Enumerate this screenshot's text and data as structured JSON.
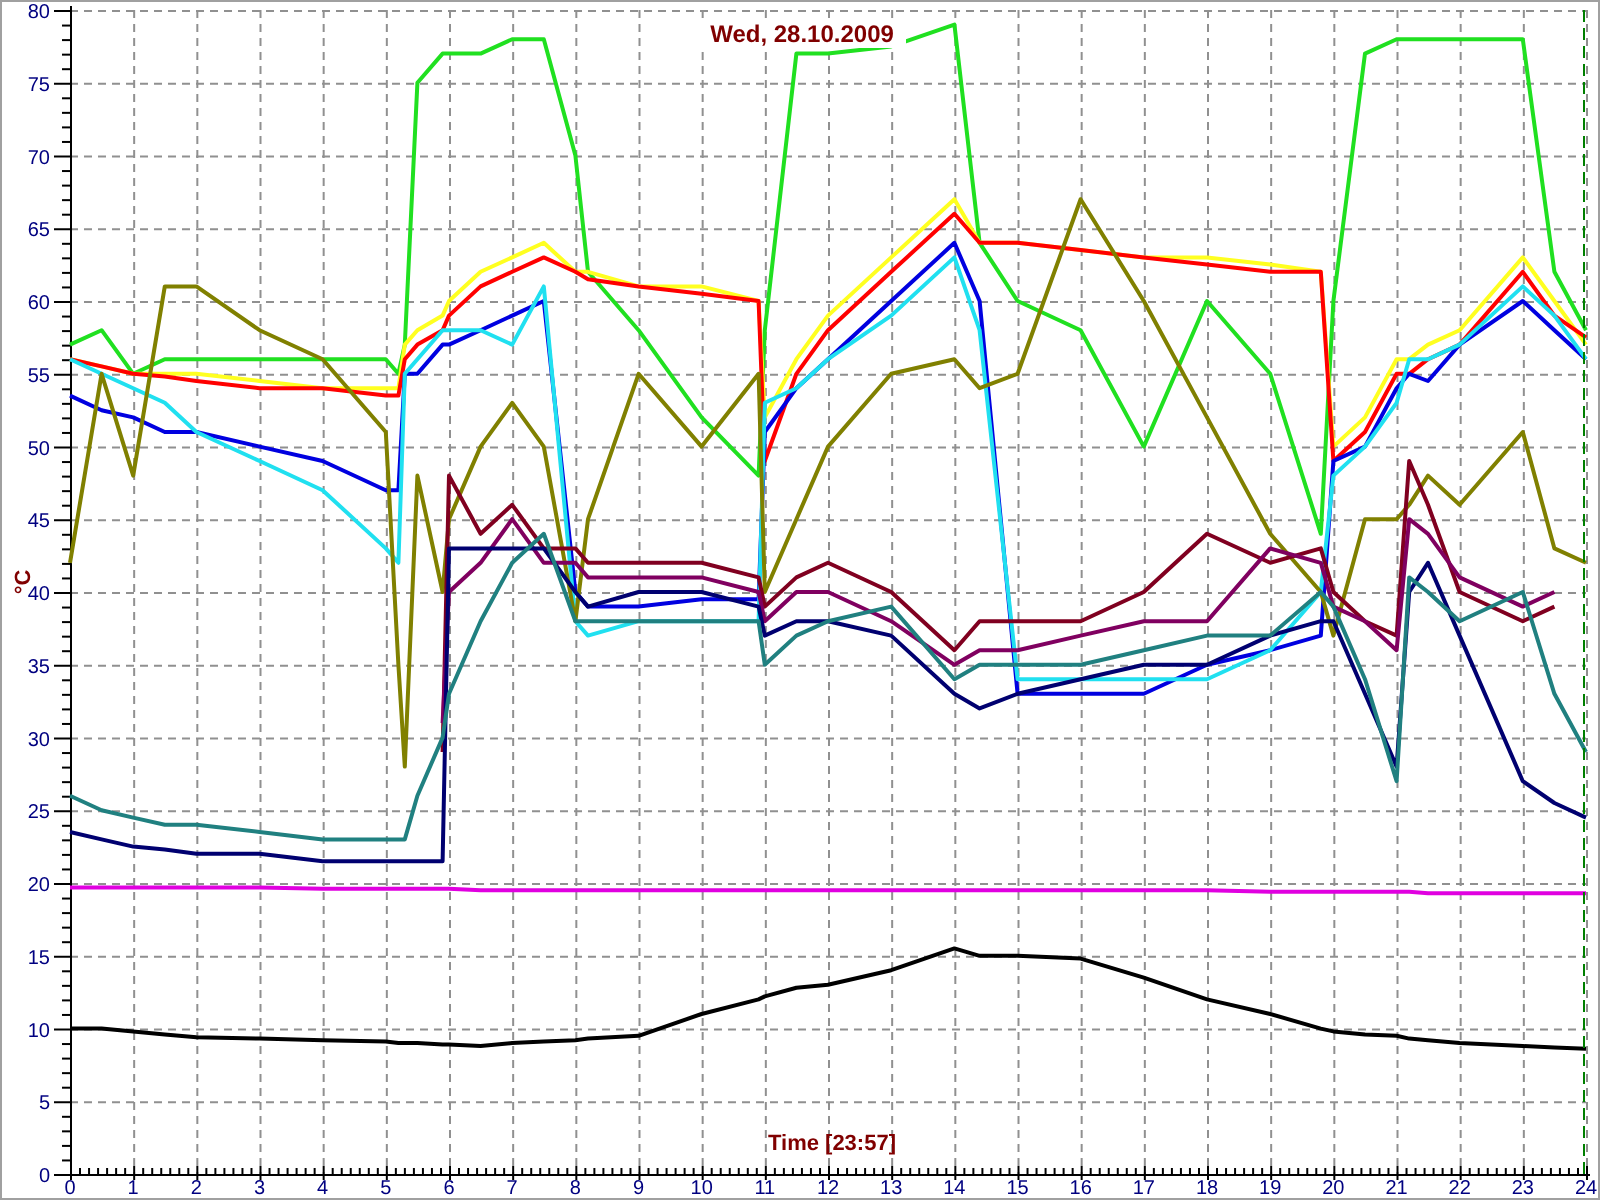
{
  "chart": {
    "chart_data": {
      "type": "line",
      "title": "Wed, 28.10.2009",
      "xlabel": "Time [23:57]",
      "ylabel": "°C",
      "x": [
        0,
        0.5,
        1,
        1.5,
        2,
        3,
        4,
        5,
        5.2,
        5.3,
        5.5,
        5.9,
        6,
        6.5,
        7,
        7.5,
        8,
        8.2,
        9,
        10,
        10.9,
        11,
        11.5,
        12,
        13,
        14,
        14.4,
        15,
        16,
        17,
        18,
        19,
        19.8,
        20,
        20.5,
        21,
        21.2,
        21.5,
        22,
        23,
        23.5,
        24
      ],
      "xlim": [
        0,
        24
      ],
      "ylim": [
        0,
        80
      ],
      "xticks": [
        0,
        1,
        2,
        3,
        4,
        5,
        6,
        7,
        8,
        9,
        10,
        11,
        12,
        13,
        14,
        15,
        16,
        17,
        18,
        19,
        20,
        21,
        22,
        23,
        24
      ],
      "yticks": [
        0,
        5,
        10,
        15,
        20,
        25,
        30,
        35,
        40,
        45,
        50,
        55,
        60,
        65,
        70,
        75,
        80
      ],
      "series": [
        {
          "color": "#20e020",
          "values": [
            57,
            58,
            55,
            56,
            56,
            56,
            56,
            56,
            55,
            57,
            75,
            77,
            77,
            77,
            78,
            78,
            70,
            62,
            58,
            52,
            48,
            58,
            77,
            77,
            77.5,
            79,
            64,
            60,
            58,
            50,
            60,
            55,
            44,
            60,
            77,
            78,
            78,
            78,
            78,
            78,
            62,
            58
          ]
        },
        {
          "color": "#ffff20",
          "values": [
            56,
            55.5,
            55,
            55,
            55,
            54.5,
            54,
            54,
            54,
            57,
            58,
            59,
            60,
            62,
            63,
            64,
            62,
            62,
            61,
            61,
            60,
            52,
            56,
            59,
            63,
            67,
            64,
            64,
            63.5,
            63,
            63,
            62.5,
            62,
            50,
            52,
            56,
            56,
            57,
            58,
            63,
            60,
            57
          ]
        },
        {
          "color": "#ff0000",
          "values": [
            56,
            55.5,
            55,
            54.8,
            54.5,
            54,
            54,
            53.5,
            53.5,
            56,
            57,
            58,
            59,
            61,
            62,
            63,
            62,
            61.5,
            61,
            60.5,
            60,
            49,
            55,
            58,
            62,
            66,
            64,
            64,
            63.5,
            63,
            62.5,
            62,
            62,
            49,
            51,
            55,
            55,
            56,
            57,
            62,
            59,
            57.5
          ]
        },
        {
          "color": "#0000e0",
          "values": [
            53.5,
            52.5,
            52,
            51,
            51,
            50,
            49,
            47,
            47,
            55,
            55,
            57,
            57,
            58,
            59,
            60,
            40,
            39,
            39,
            39.5,
            39.5,
            51,
            54,
            56,
            60,
            64,
            60,
            33,
            33,
            33,
            35,
            36,
            37,
            49,
            50,
            54,
            55,
            54.5,
            57,
            60,
            58,
            56
          ]
        },
        {
          "color": "#20e0f0",
          "values": [
            56,
            55,
            54,
            53,
            51,
            49,
            47,
            43,
            42,
            55,
            56,
            58,
            58,
            58,
            57,
            61,
            38,
            37,
            38,
            38,
            38,
            53,
            54,
            56,
            59,
            63,
            58,
            34,
            34,
            34,
            34,
            36,
            40,
            48,
            50,
            53,
            56,
            56,
            57,
            61,
            59,
            56
          ]
        },
        {
          "color": "#808000",
          "values": [
            42,
            55,
            48,
            61,
            61,
            58,
            56,
            51,
            35,
            28,
            48,
            40,
            45,
            50,
            53,
            50,
            38,
            45,
            55,
            50,
            55,
            40,
            45,
            50,
            55,
            56,
            54,
            55,
            67,
            60,
            52,
            44,
            40,
            37,
            45,
            45,
            46,
            48,
            46,
            51,
            43,
            42
          ]
        },
        {
          "color": "#800020",
          "values": [
            null,
            null,
            null,
            null,
            null,
            null,
            null,
            null,
            null,
            null,
            null,
            29,
            48,
            44,
            46,
            43,
            43,
            42,
            42,
            42,
            41,
            39,
            41,
            42,
            40,
            36,
            38,
            38,
            38,
            40,
            44,
            42,
            43,
            40,
            38,
            37,
            49,
            46,
            40,
            38,
            39,
            null
          ]
        },
        {
          "color": "#800060",
          "values": [
            null,
            null,
            null,
            null,
            null,
            null,
            null,
            null,
            null,
            null,
            null,
            31,
            40,
            42,
            45,
            42,
            42,
            41,
            41,
            41,
            40,
            38,
            40,
            40,
            38,
            35,
            36,
            36,
            37,
            38,
            38,
            43,
            42,
            39,
            38,
            36,
            45,
            44,
            41,
            39,
            40,
            null
          ]
        },
        {
          "color": "#000070",
          "values": [
            23.5,
            23,
            22.5,
            22.3,
            22,
            22,
            21.5,
            21.5,
            21.5,
            21.5,
            21.5,
            21.5,
            43,
            43,
            43,
            43,
            40,
            39,
            40,
            40,
            39,
            37,
            38,
            38,
            37,
            33,
            32,
            33,
            34,
            35,
            35,
            37,
            38,
            38,
            33,
            28,
            40,
            42,
            37,
            27,
            25.5,
            24.5
          ]
        },
        {
          "color": "#208080",
          "values": [
            26,
            25,
            24.5,
            24,
            24,
            23.5,
            23,
            23,
            23,
            23,
            26,
            30,
            33,
            38,
            42,
            44,
            38,
            38,
            38,
            38,
            38,
            35,
            37,
            38,
            39,
            34,
            35,
            35,
            35,
            36,
            37,
            37,
            40,
            39,
            34,
            27,
            41,
            40,
            38,
            40,
            33,
            29
          ]
        },
        {
          "color": "#e000e0",
          "values": [
            19.7,
            19.7,
            19.7,
            19.7,
            19.7,
            19.7,
            19.6,
            19.6,
            19.6,
            19.6,
            19.6,
            19.6,
            19.6,
            19.5,
            19.5,
            19.5,
            19.5,
            19.5,
            19.5,
            19.5,
            19.5,
            19.5,
            19.5,
            19.5,
            19.5,
            19.5,
            19.5,
            19.5,
            19.5,
            19.5,
            19.5,
            19.4,
            19.4,
            19.4,
            19.4,
            19.4,
            19.4,
            19.3,
            19.3,
            19.3,
            19.3,
            19.3
          ]
        },
        {
          "color": "#000000",
          "values": [
            10,
            10,
            9.8,
            9.6,
            9.4,
            9.3,
            9.2,
            9.1,
            9,
            9,
            9,
            8.9,
            8.9,
            8.8,
            9,
            9.1,
            9.2,
            9.3,
            9.5,
            11,
            12,
            12.2,
            12.8,
            13,
            14,
            15.5,
            15,
            15,
            14.8,
            13.5,
            12,
            11,
            10,
            9.8,
            9.6,
            9.5,
            9.3,
            9.2,
            9,
            8.8,
            8.7,
            8.6
          ]
        }
      ],
      "grid": true
    }
  }
}
